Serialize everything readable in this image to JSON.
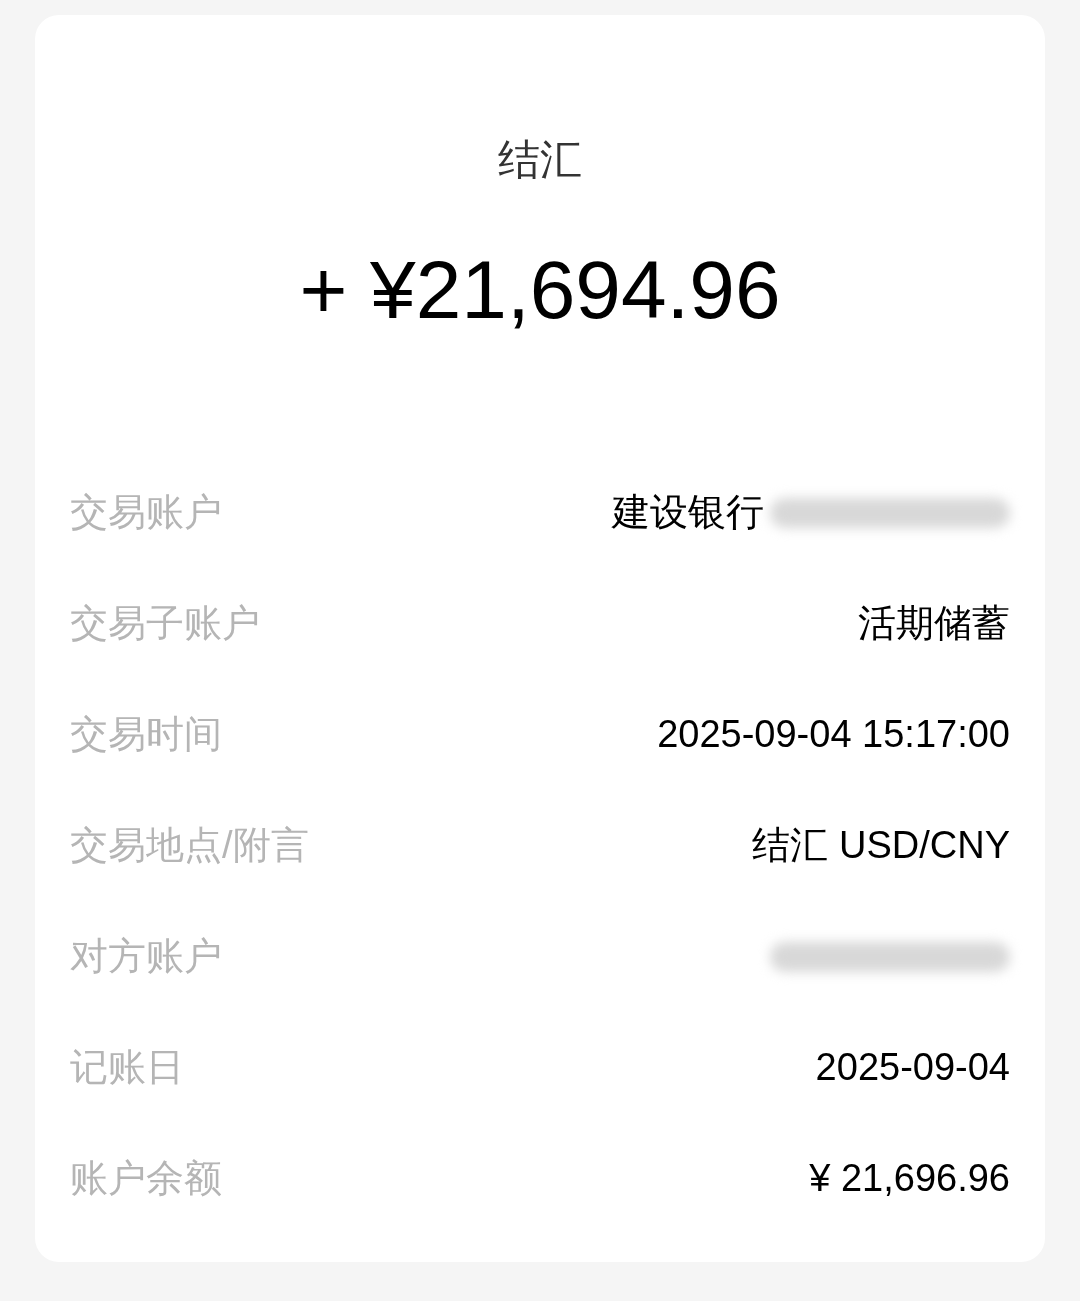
{
  "title": "结汇",
  "amount": "+ ¥21,694.96",
  "rows": [
    {
      "label": "交易账户",
      "value": "建设银行",
      "redacted": true
    },
    {
      "label": "交易子账户",
      "value": "活期储蓄",
      "redacted": false
    },
    {
      "label": "交易时间",
      "value": "2025-09-04 15:17:00",
      "redacted": false
    },
    {
      "label": "交易地点/附言",
      "value": "结汇 USD/CNY",
      "redacted": false
    },
    {
      "label": "对方账户",
      "redacted": true
    },
    {
      "label": "记账日",
      "value": "2025-09-04",
      "redacted": false
    },
    {
      "label": "账户余额",
      "value": "¥ 21,696.96",
      "redacted": false
    }
  ]
}
